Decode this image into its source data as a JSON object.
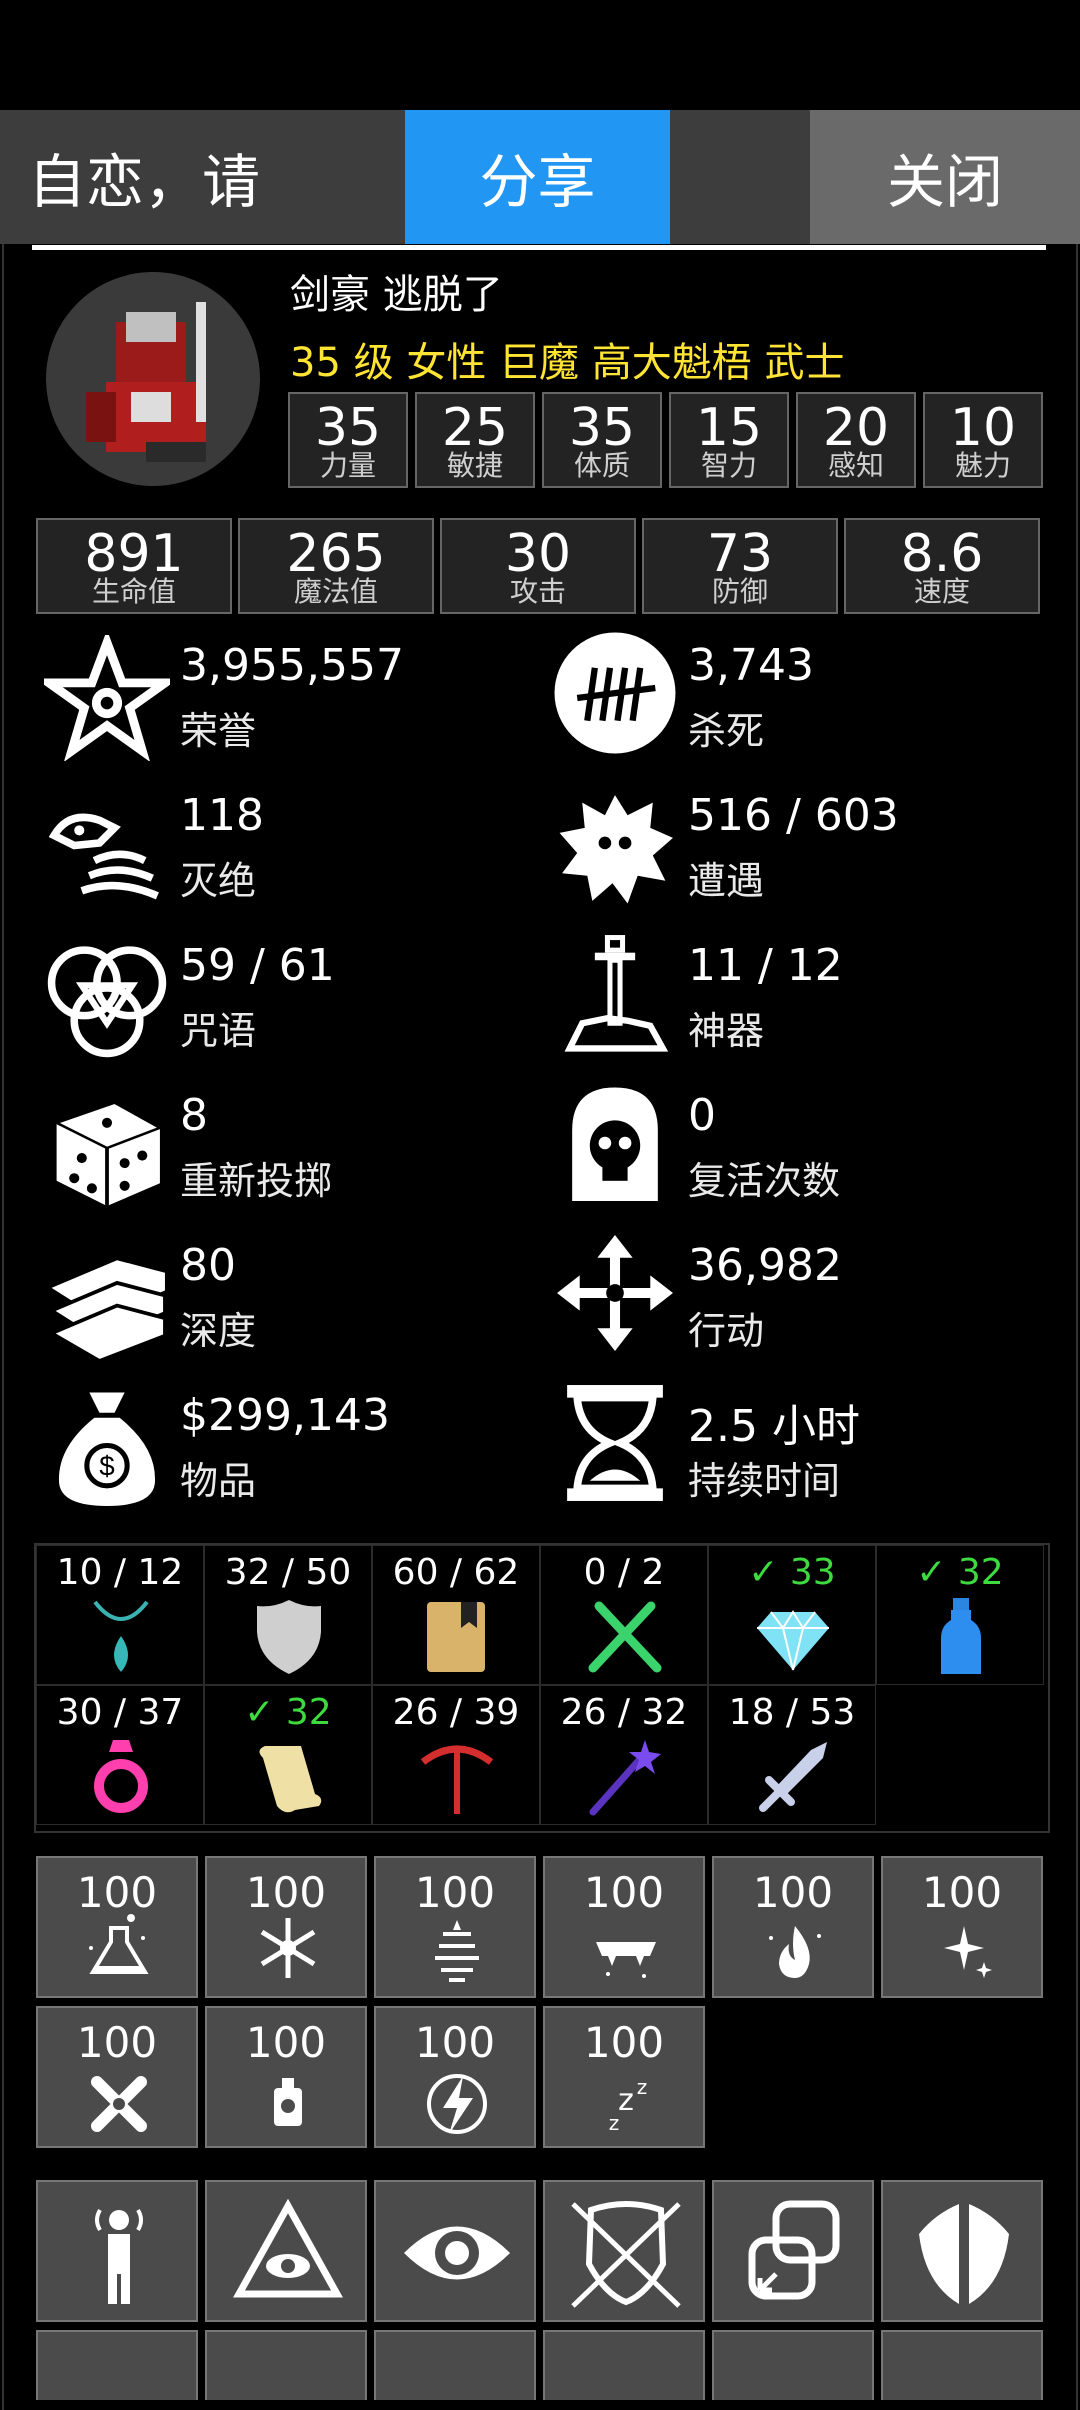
{
  "topbar": {
    "title": "自恋，请",
    "share": "分享",
    "close": "关闭"
  },
  "hero": {
    "name": "剑豪 逃脱了",
    "desc": "35 级 女性 巨魔 高大魁梧 武士"
  },
  "attributes": [
    {
      "value": "35",
      "label": "力量"
    },
    {
      "value": "25",
      "label": "敏捷"
    },
    {
      "value": "35",
      "label": "体质"
    },
    {
      "value": "15",
      "label": "智力"
    },
    {
      "value": "20",
      "label": "感知"
    },
    {
      "value": "10",
      "label": "魅力"
    }
  ],
  "stats": [
    {
      "value": "891",
      "label": "生命值"
    },
    {
      "value": "265",
      "label": "魔法值"
    },
    {
      "value": "30",
      "label": "攻击"
    },
    {
      "value": "73",
      "label": "防御"
    },
    {
      "value": "8.6",
      "label": "速度"
    }
  ],
  "info": [
    {
      "value": "3,955,557",
      "label": "荣誉",
      "icon": "honor-star-icon"
    },
    {
      "value": "3,743",
      "label": "杀死",
      "icon": "tally-kills-icon"
    },
    {
      "value": "118",
      "label": "灭绝",
      "icon": "skeleton-icon"
    },
    {
      "value": "516 / 603",
      "label": "遭遇",
      "icon": "monster-blob-icon"
    },
    {
      "value": "59 / 61",
      "label": "咒语",
      "icon": "triquetra-icon"
    },
    {
      "value": "11 / 12",
      "label": "神器",
      "icon": "sword-in-stone-icon"
    },
    {
      "value": "8",
      "label": "重新投掷",
      "icon": "dice-icon"
    },
    {
      "value": "0",
      "label": "复活次数",
      "icon": "skull-tombstone-icon"
    },
    {
      "value": "80",
      "label": "深度",
      "icon": "stairs-icon"
    },
    {
      "value": "36,982",
      "label": "行动",
      "icon": "move-arrows-icon"
    },
    {
      "value": "$299,143",
      "label": "物品",
      "icon": "money-bag-icon"
    },
    {
      "value": "2.5 小时",
      "label": "持续时间",
      "icon": "hourglass-icon"
    }
  ],
  "items": [
    {
      "value": "10 / 12",
      "icon": "amulet-icon",
      "ok": false
    },
    {
      "value": "32 / 50",
      "icon": "shield-icon",
      "ok": false
    },
    {
      "value": "60 / 62",
      "icon": "book-icon",
      "ok": false
    },
    {
      "value": "0 / 2",
      "icon": "fork-knife-icon",
      "ok": false
    },
    {
      "value": "✓ 33",
      "icon": "diamond-icon",
      "ok": true
    },
    {
      "value": "✓ 32",
      "icon": "potion-bottle-icon",
      "ok": true
    },
    {
      "value": "30 / 37",
      "icon": "ring-icon",
      "ok": false
    },
    {
      "value": "✓ 32",
      "icon": "scroll-icon",
      "ok": true
    },
    {
      "value": "26 / 39",
      "icon": "pickaxe-icon",
      "ok": false
    },
    {
      "value": "26 / 32",
      "icon": "magic-wand-icon",
      "ok": false
    },
    {
      "value": "18 / 53",
      "icon": "sword-icon",
      "ok": false
    }
  ],
  "resistances": [
    {
      "value": "100",
      "icon": "acid-flask-icon"
    },
    {
      "value": "100",
      "icon": "frost-icon"
    },
    {
      "value": "100",
      "icon": "tornado-icon"
    },
    {
      "value": "100",
      "icon": "bite-icon"
    },
    {
      "value": "100",
      "icon": "fire-icon"
    },
    {
      "value": "100",
      "icon": "sparkle-icon"
    },
    {
      "value": "100",
      "icon": "cross-bone-icon"
    },
    {
      "value": "100",
      "icon": "poison-bottle-icon"
    },
    {
      "value": "100",
      "icon": "lightning-icon"
    },
    {
      "value": "100",
      "icon": "sleep-icon"
    }
  ],
  "skills": [
    "telepathy-icon",
    "all-seeing-eye-icon",
    "eye-icon",
    "armor-icon",
    "copy-icon",
    "wings-icon"
  ]
}
